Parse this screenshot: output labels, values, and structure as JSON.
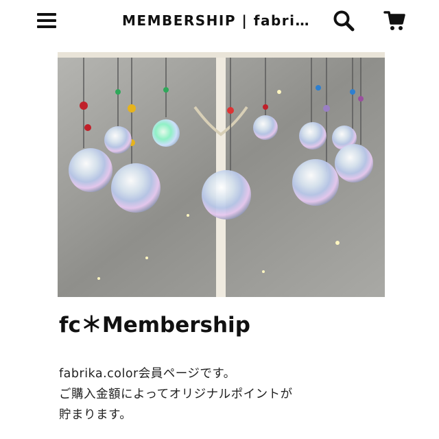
{
  "header": {
    "title": "MEMBERSHIP | fabri…",
    "menu_icon": "hamburger-menu-icon",
    "search_icon": "search-icon",
    "cart_icon": "shopping-cart-icon"
  },
  "hero": {
    "image_alt": "crystal-suncatcher-photo"
  },
  "main": {
    "heading": "fc＊Membership",
    "description_lines": [
      "fabrika.color会員ページです。",
      "ご購入金額によってオリジナルポイントが",
      "貯まります。"
    ]
  },
  "colors": {
    "text": "#111111",
    "background": "#ffffff"
  }
}
